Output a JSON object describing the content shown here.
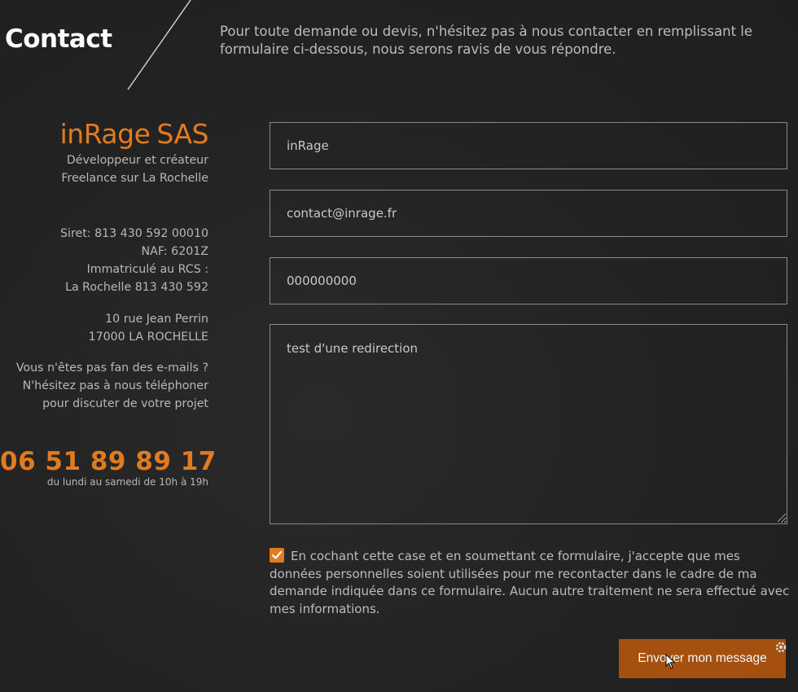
{
  "header": {
    "title": "Contact",
    "intro": "Pour toute demande ou devis, n'hésitez pas à nous contacter en remplissant le formulaire ci-dessous, nous serons ravis de vous répondre."
  },
  "company": {
    "name_bold": "inRage",
    "name_light": "SAS",
    "tagline_line1": "Développeur et créateur",
    "tagline_line2": "Freelance sur La Rochelle",
    "siret": "Siret: 813 430 592 00010",
    "naf": "NAF: 6201Z",
    "rcs_line1": "Immatriculé au RCS :",
    "rcs_line2": "La Rochelle 813 430 592",
    "address_line1": "10 rue Jean Perrin",
    "address_line2": "17000 LA ROCHELLE",
    "call_line1": "Vous n'êtes pas fan des e-mails ?",
    "call_line2": "N'hésitez pas à nous téléphoner",
    "call_line3": "pour discuter de votre projet",
    "phone": "06 51 89 89 17",
    "hours": "du lundi au samedi de 10h à 19h"
  },
  "form": {
    "name_value": "inRage",
    "email_value": "contact@inrage.fr",
    "phone_value": "000000000",
    "message_value": "test d'une redirection",
    "consent_checked": true,
    "consent_text": "En cochant cette case et en soumettant ce formulaire, j'accepte que mes données personnelles soient utilisées pour me recontacter dans le cadre de ma demande indiquée dans ce formulaire. Aucun autre traitement ne sera effectué avec mes informations.",
    "submit_label": "Envoyer mon message"
  },
  "colors": {
    "accent": "#e07b20",
    "button": "#a5500f",
    "background": "#242424"
  }
}
